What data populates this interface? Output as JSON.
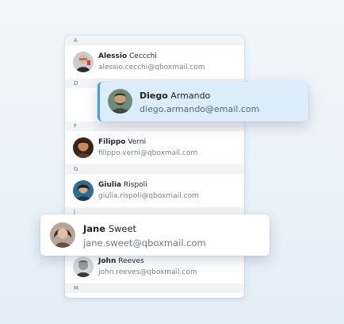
{
  "colors": {
    "accent": "#3fa0e4",
    "drag_highlight": "#dcecf8",
    "section_bg": "#f1f3f5"
  },
  "sections": [
    "A",
    "D",
    "F",
    "G",
    "J",
    "M"
  ],
  "contacts": [
    {
      "first": "Alessio",
      "last": "Ceccchi",
      "email": "alessio.cecchi@qboxmail.com",
      "avatar": "avatar-alessio"
    },
    {
      "first": "Filippo",
      "last": "Verni",
      "email": "filippo.verni@qboxmail.com",
      "avatar": "avatar-filippo"
    },
    {
      "first": "Giulia",
      "last": "Rispoli",
      "email": "giulia.rispoli@qboxmail.com",
      "avatar": "avatar-giulia"
    },
    {
      "first": "John",
      "last": "Reeves",
      "email": "john.reeves@qboxmail.com",
      "avatar": "avatar-john"
    }
  ],
  "floating_cards": {
    "diego": {
      "first": "Diego",
      "last": "Armando",
      "email": "diego.armando@email.com",
      "avatar": "avatar-diego"
    },
    "jane": {
      "first": "Jane",
      "last": "Sweet",
      "email": "jane.sweet@qboxmail.com",
      "avatar": "avatar-jane"
    }
  }
}
